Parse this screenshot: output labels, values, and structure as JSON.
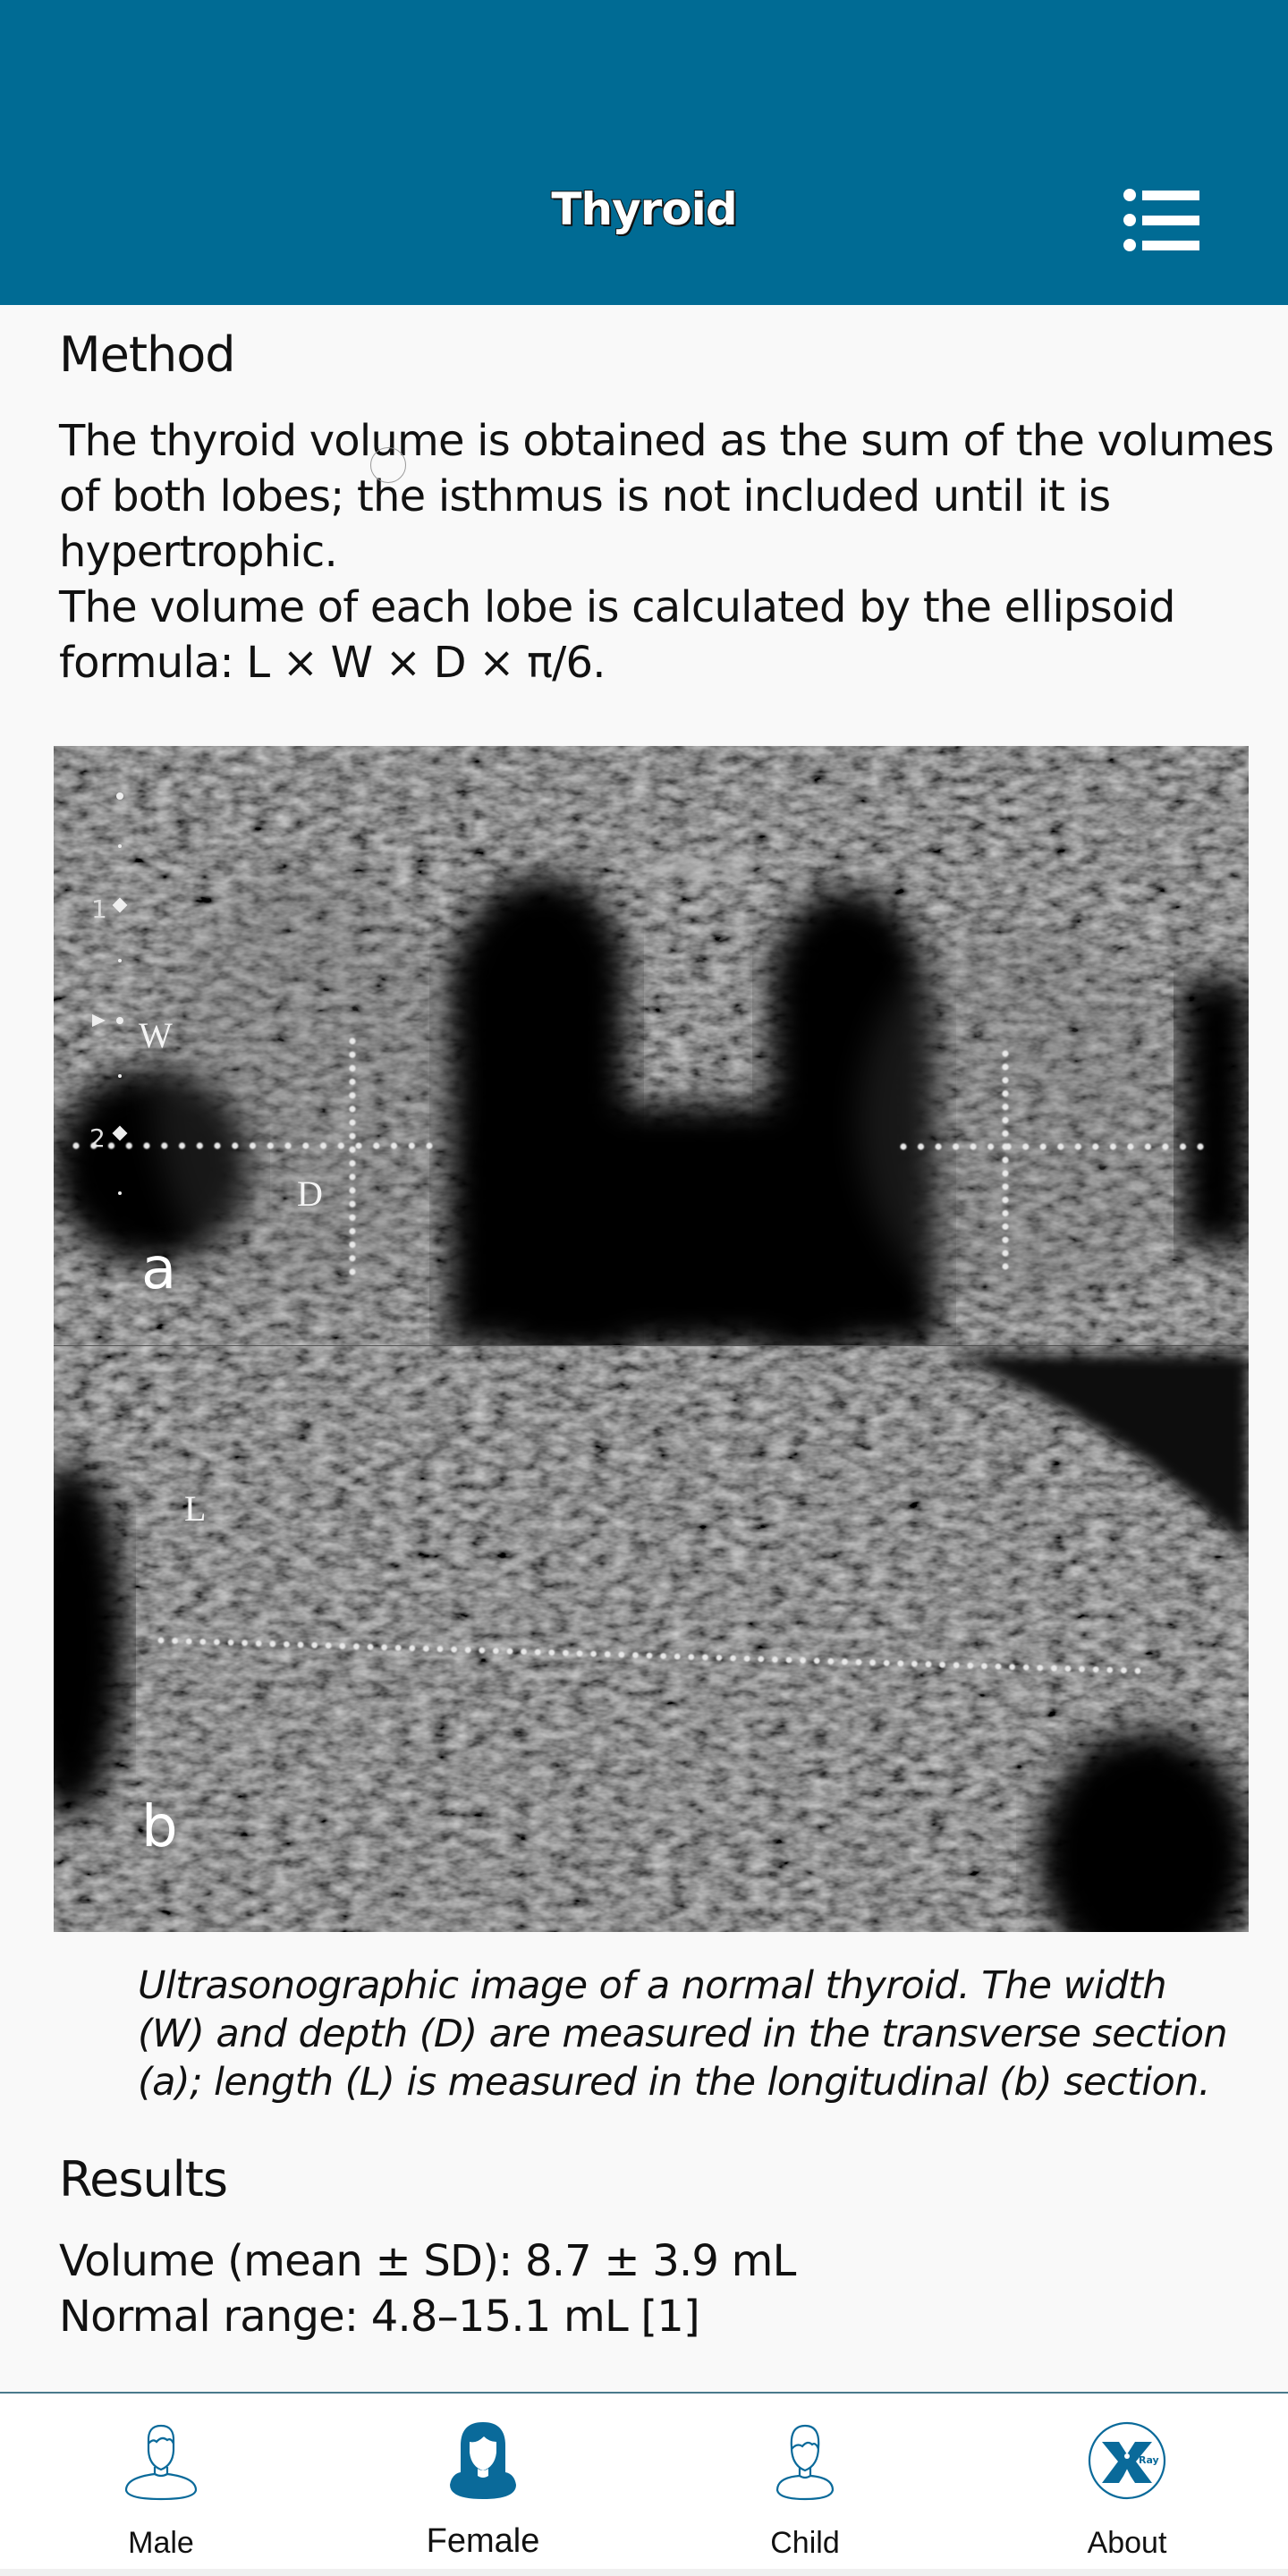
{
  "header": {
    "title": "Thyroid",
    "menu_icon": "list-menu-icon",
    "background_color": "#006b94"
  },
  "method": {
    "title": "Method",
    "paragraphs": [
      "The thyroid volume is obtained as the sum of the volumes of both lobes; the isthmus is not included until it is hypertrophic.",
      "The volume of each lobe is calculated by the ellipsoid formula: L × W × D × π/6."
    ]
  },
  "figure": {
    "panel_a_label": "a",
    "panel_b_label": "b",
    "measure_width_label": "W",
    "measure_depth_label": "D",
    "measure_length_label": "L",
    "depth_marker_1": "1",
    "depth_marker_2": "2",
    "caption": "Ultrasonographic image of a normal thyroid. The width (W) and depth (D) are measured in the transverse section (a); length (L) is measured in the longitudinal (b) section."
  },
  "results": {
    "title": "Results",
    "volume_line": "Volume (mean ± SD): 8.7 ± 3.9 mL",
    "range_line": "Normal range: 4.8–15.1 mL [1]"
  },
  "tabbar": {
    "accent_color": "#0a6a9a",
    "active_tab": "Female",
    "tabs": [
      {
        "label": "Male",
        "icon": "male-person-icon"
      },
      {
        "label": "Female",
        "icon": "female-person-icon"
      },
      {
        "label": "Child",
        "icon": "child-person-icon"
      },
      {
        "label": "About",
        "icon": "xray-logo-icon"
      }
    ]
  }
}
